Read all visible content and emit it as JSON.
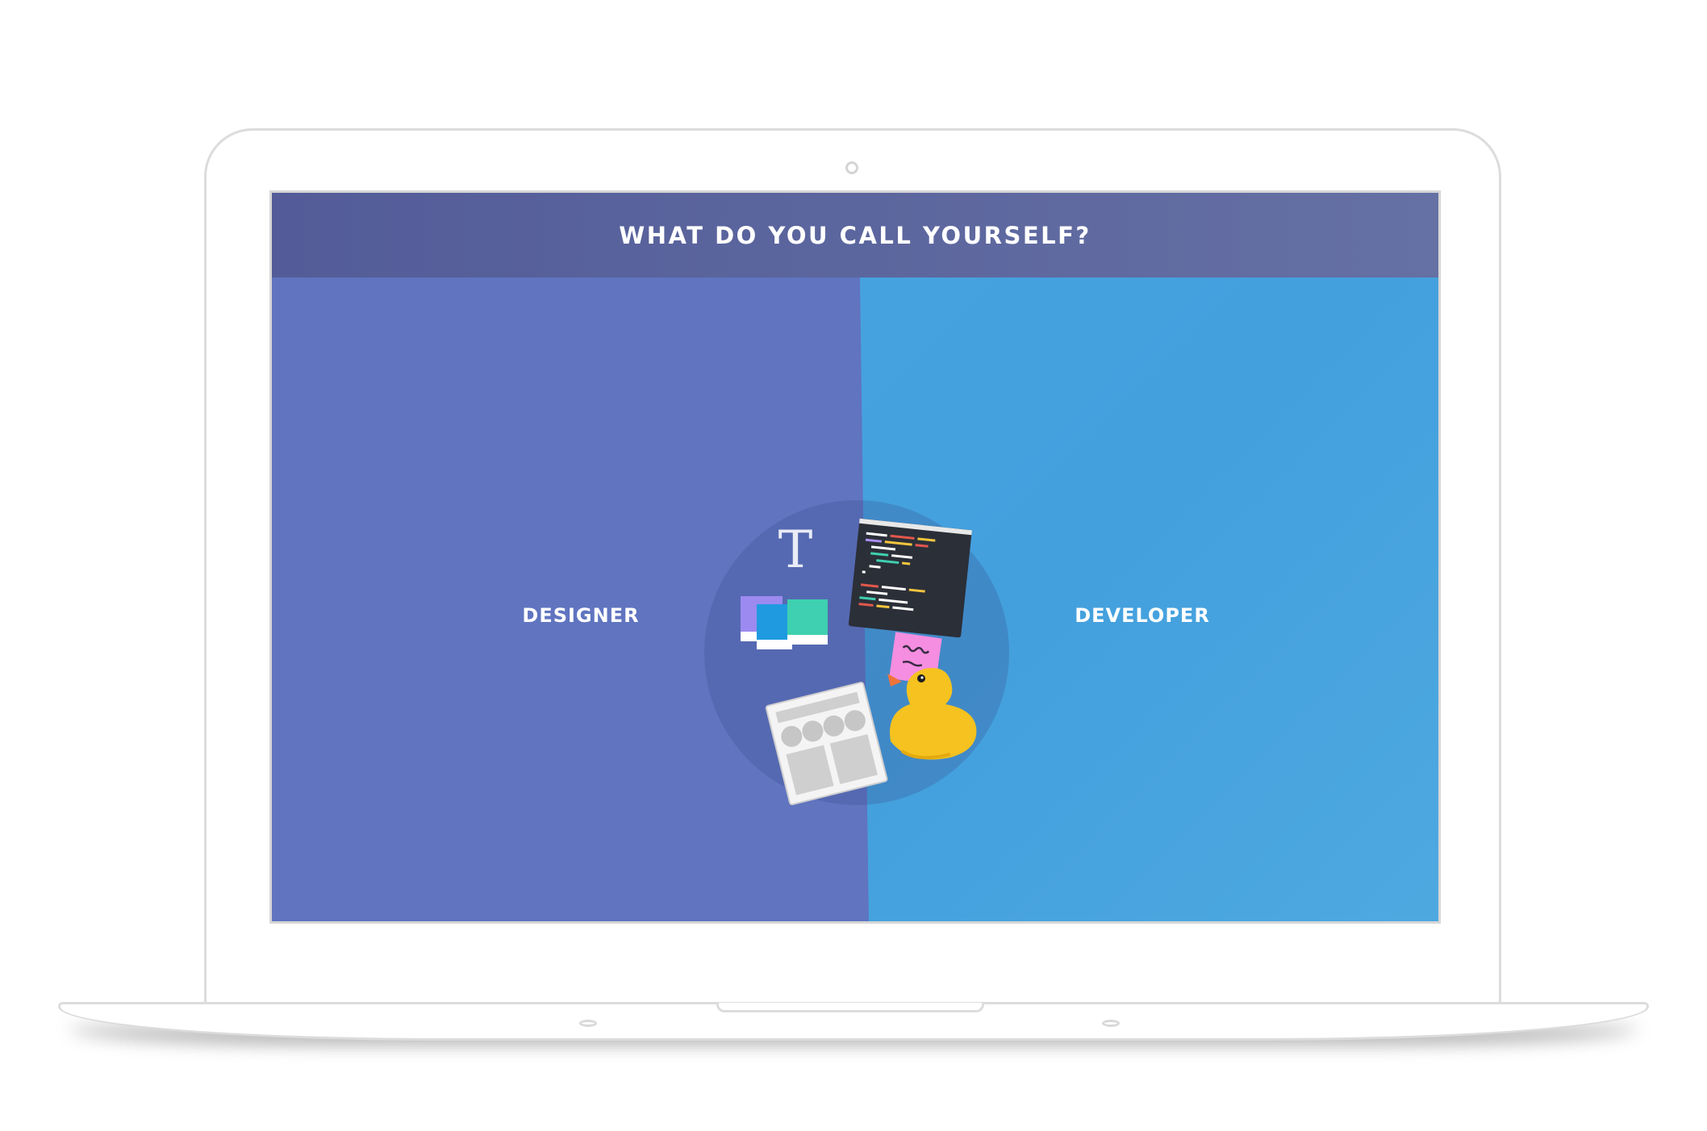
{
  "screen": {
    "header": {
      "title": "WHAT DO YOU CALL YOURSELF?"
    },
    "options": [
      {
        "label": "DESIGNER",
        "color": "#6074c0"
      },
      {
        "label": "DEVELOPER",
        "color": "#45a1de"
      }
    ],
    "illustration": {
      "icons": [
        "typography-icon",
        "color-swatches-icon",
        "wireframe-icon",
        "code-editor-icon",
        "sticky-note-icon",
        "rubber-duck-icon"
      ],
      "typography_glyph": "T"
    }
  },
  "colors": {
    "header_bg": "#5a6299",
    "designer_bg": "#6074c0",
    "developer_bg": "#45a1de",
    "text": "#ffffff"
  }
}
